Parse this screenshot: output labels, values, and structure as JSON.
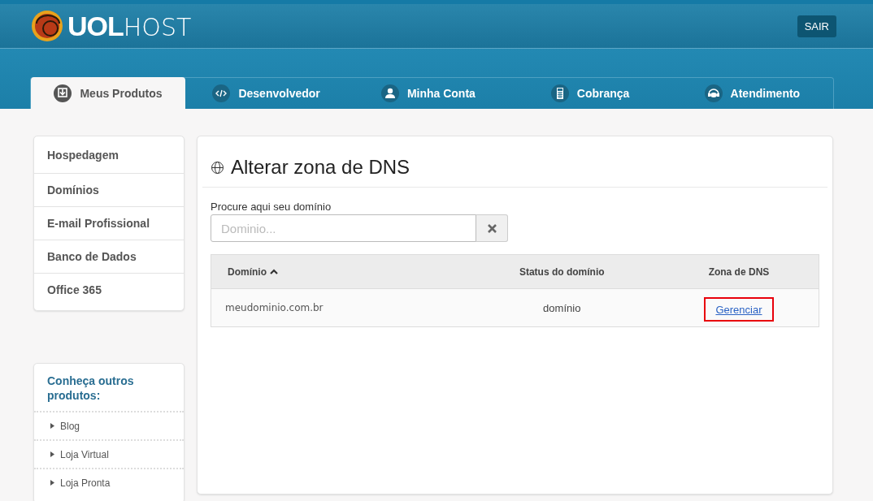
{
  "header": {
    "logo": {
      "bold_part": "UOL",
      "light_part": "HOST"
    },
    "logout_button": "SAIR"
  },
  "tabs": [
    {
      "label": "Meus Produtos",
      "kind": "products",
      "selected": true
    },
    {
      "label": "Desenvolvedor",
      "kind": "developer",
      "selected": false
    },
    {
      "label": "Minha Conta",
      "kind": "account",
      "selected": false
    },
    {
      "label": "Cobrança",
      "kind": "billing",
      "selected": false
    },
    {
      "label": "Atendimento",
      "kind": "support",
      "selected": false
    }
  ],
  "sidebar": {
    "items": [
      "Hospedagem",
      "Domínios",
      "E-mail Profissional",
      "Banco de Dados",
      "Office 365"
    ]
  },
  "other_products": {
    "title": "Conheça outros produtos:",
    "items": [
      "Blog",
      "Loja Virtual",
      "Loja Pronta"
    ]
  },
  "main": {
    "title": "Alterar zona de DNS",
    "search": {
      "label": "Procure aqui seu domínio",
      "placeholder": "Dominio..."
    },
    "table": {
      "columns": [
        {
          "label": "Domínio",
          "sorted": true
        },
        {
          "label": "Status do domínio",
          "sorted": false
        },
        {
          "label": "Zona de DNS",
          "sorted": false
        }
      ],
      "rows": [
        {
          "domain": "meudominio.com.br",
          "status": "domínio",
          "action": "Gerenciar",
          "highlighted": true
        }
      ]
    }
  }
}
